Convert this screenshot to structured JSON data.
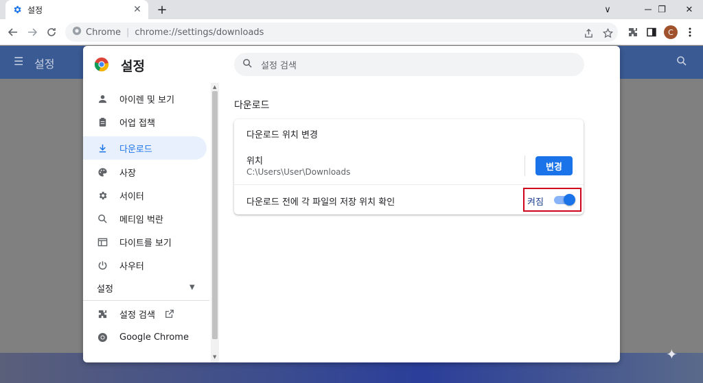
{
  "tab": {
    "title": "설정",
    "close": "✕",
    "new_tab": "+"
  },
  "window": {
    "minimize": "∨",
    "restore": "❐",
    "close": "✕"
  },
  "toolbar": {
    "site_name": "Chrome",
    "separator": "|",
    "url": "chrome://settings/downloads",
    "avatar_letter": "C"
  },
  "settings_header": {
    "title": "설정"
  },
  "dialog": {
    "title": "설정",
    "search_placeholder": "설정 검색"
  },
  "nav": {
    "items": [
      {
        "label": "아이렌 및 보기",
        "icon": "person-icon"
      },
      {
        "label": "어업 접책",
        "icon": "clipboard-icon"
      },
      {
        "label": "다운로드",
        "icon": "download-icon",
        "active": true
      },
      {
        "label": "사장",
        "icon": "palette-icon"
      },
      {
        "label": "서이터",
        "icon": "gear-icon"
      },
      {
        "label": "메티임 벅란",
        "icon": "search-icon"
      },
      {
        "label": "다이트를 보기",
        "icon": "window-icon"
      },
      {
        "label": "사우터",
        "icon": "power-icon"
      }
    ],
    "section_label": "설정",
    "bottom_items": [
      {
        "label": "설정 검색",
        "icon": "puzzle-icon"
      },
      {
        "label": "Google Chrome",
        "icon": "chrome-icon"
      }
    ]
  },
  "main": {
    "section_title": "다운로드",
    "card_header": "다운로드 위치 변경",
    "location_label": "위치",
    "location_path": "C:\\Users\\User\\Downloads",
    "change_button": "변경",
    "ask_label": "다운로드 전에 각 파일의 저장 위치 확인",
    "toggle_state": "켜짐",
    "toggle_on": true
  },
  "colors": {
    "accent": "#1a73e8",
    "highlight": "#d0021b",
    "header_bg": "#3a5a94"
  }
}
